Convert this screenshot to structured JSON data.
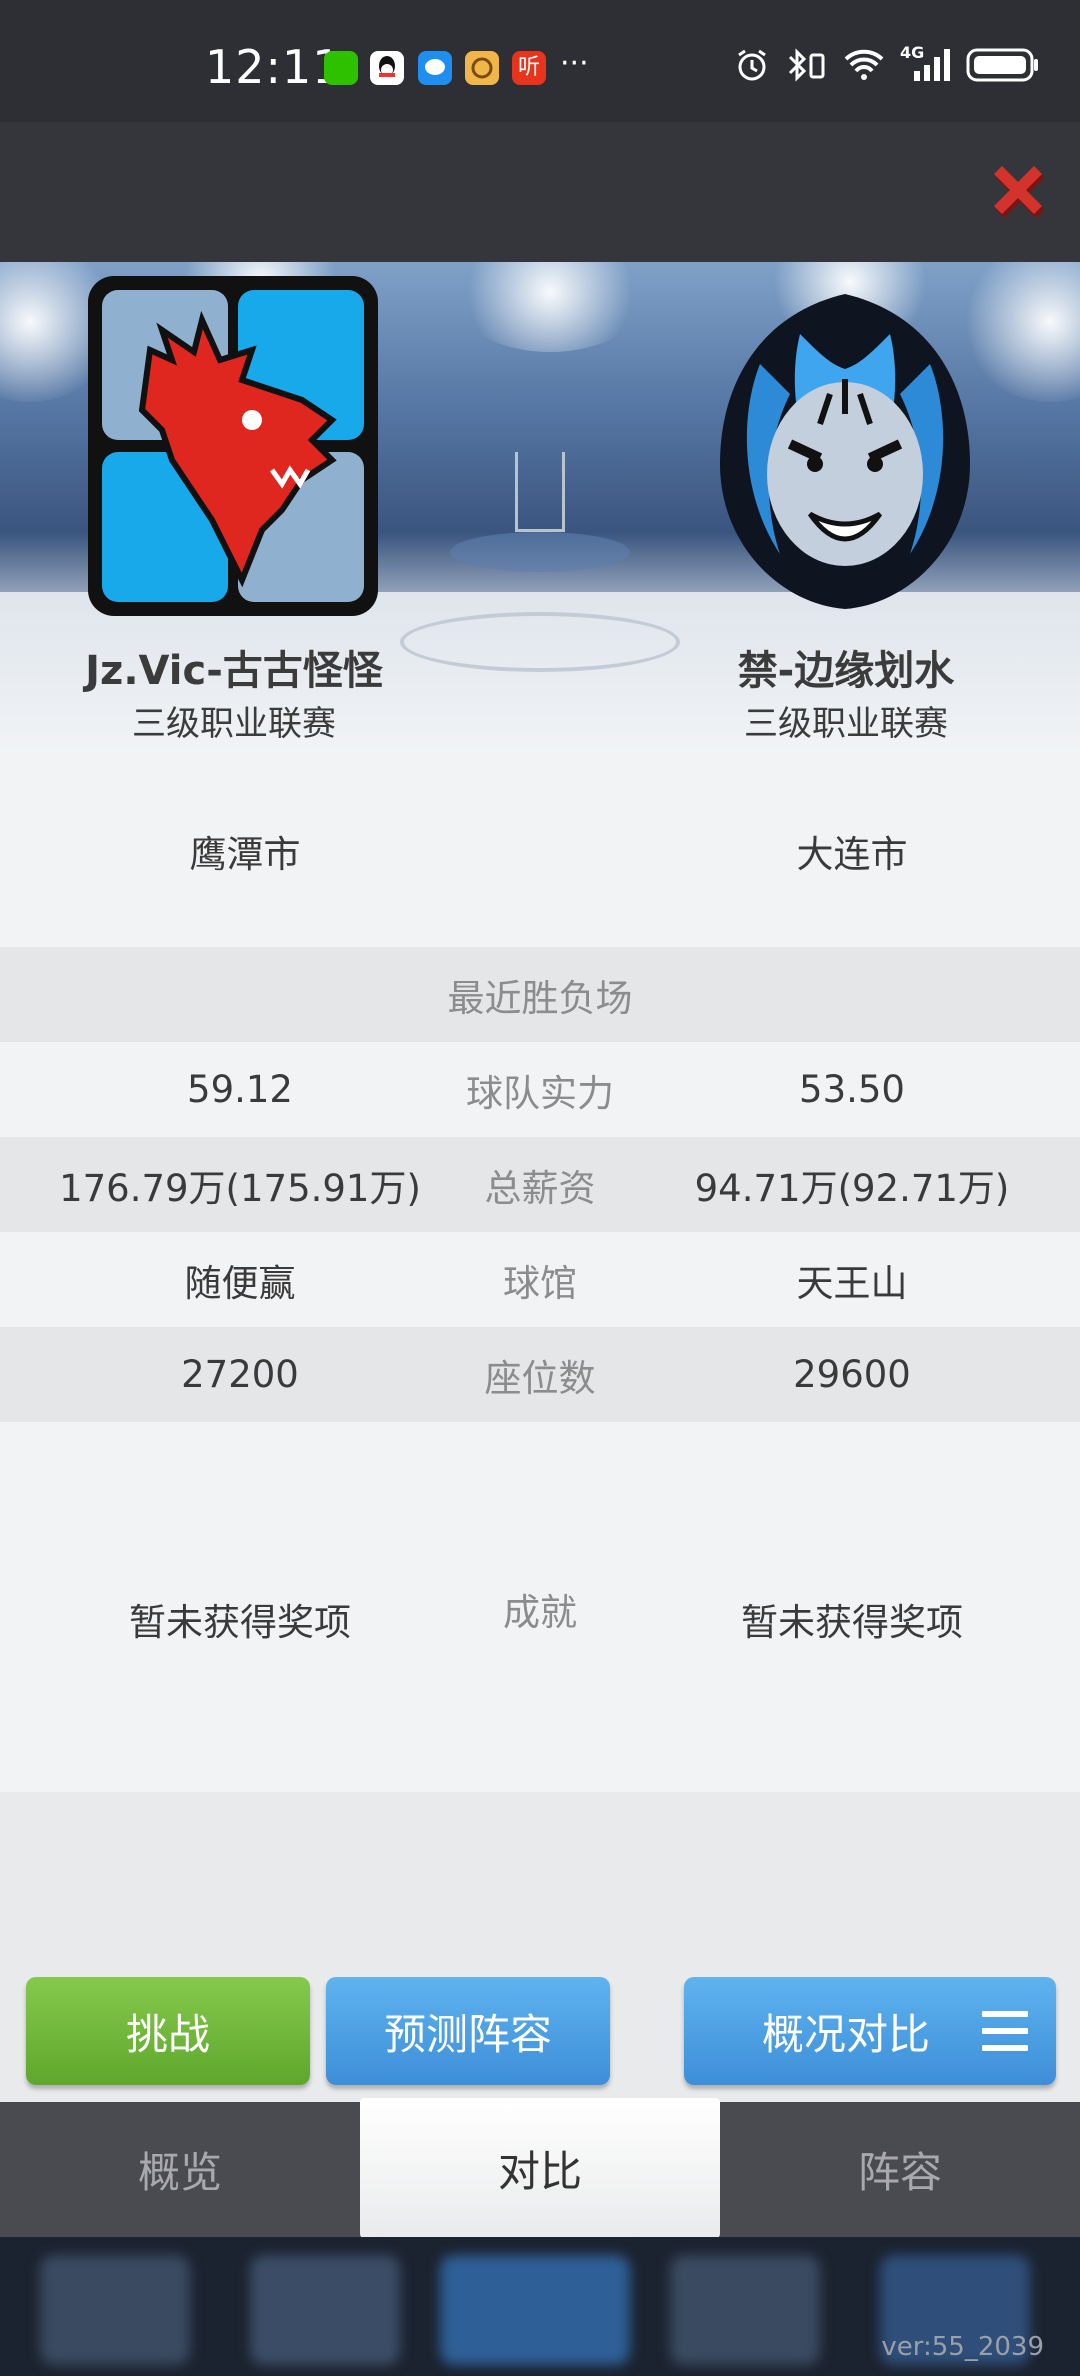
{
  "status_bar": {
    "time": "12:11",
    "more": "···",
    "icons": [
      "wechat-icon",
      "qq-icon",
      "message-icon",
      "app-icon",
      "listen-icon",
      "alarm-icon",
      "bluetooth-icon",
      "wifi-icon",
      "signal-4g-icon",
      "battery-icon"
    ],
    "network_label": "4G"
  },
  "header": {
    "close_icon": "close-icon"
  },
  "teams": {
    "left": {
      "name": "Jz.Vic-古古怪怪",
      "league": "三级职业联赛",
      "logo": "dragon-logo"
    },
    "right": {
      "name": "禁-边缘划水",
      "league": "三级职业联赛",
      "logo": "tiger-logo"
    }
  },
  "stats": {
    "city": {
      "left": "鹰潭市",
      "right": "大连市"
    },
    "recent_label": "最近胜负场",
    "strength": {
      "label": "球队实力",
      "left": "59.12",
      "right": "53.50"
    },
    "salary": {
      "label": "总薪资",
      "left": "176.79万(175.91万)",
      "right": "94.71万(92.71万)"
    },
    "arena": {
      "label": "球馆",
      "left": "随便赢",
      "right": "天王山"
    },
    "seats": {
      "label": "座位数",
      "left": "27200",
      "right": "29600"
    },
    "achievement": {
      "label": "成就",
      "left": "暂未获得奖项",
      "right": "暂未获得奖项"
    }
  },
  "actions": {
    "challenge": "挑战",
    "predict": "预测阵容",
    "overview_compare": "概况对比"
  },
  "tabs": [
    {
      "label": "概览",
      "active": false
    },
    {
      "label": "对比",
      "active": true
    },
    {
      "label": "阵容",
      "active": false
    }
  ],
  "version": "ver:55_2039",
  "colors": {
    "challenge": "#6cb83a",
    "blue": "#4a9fe6",
    "close": "#c8302e",
    "dragon": "#e0271f",
    "tiger": "#2d8ad6"
  }
}
